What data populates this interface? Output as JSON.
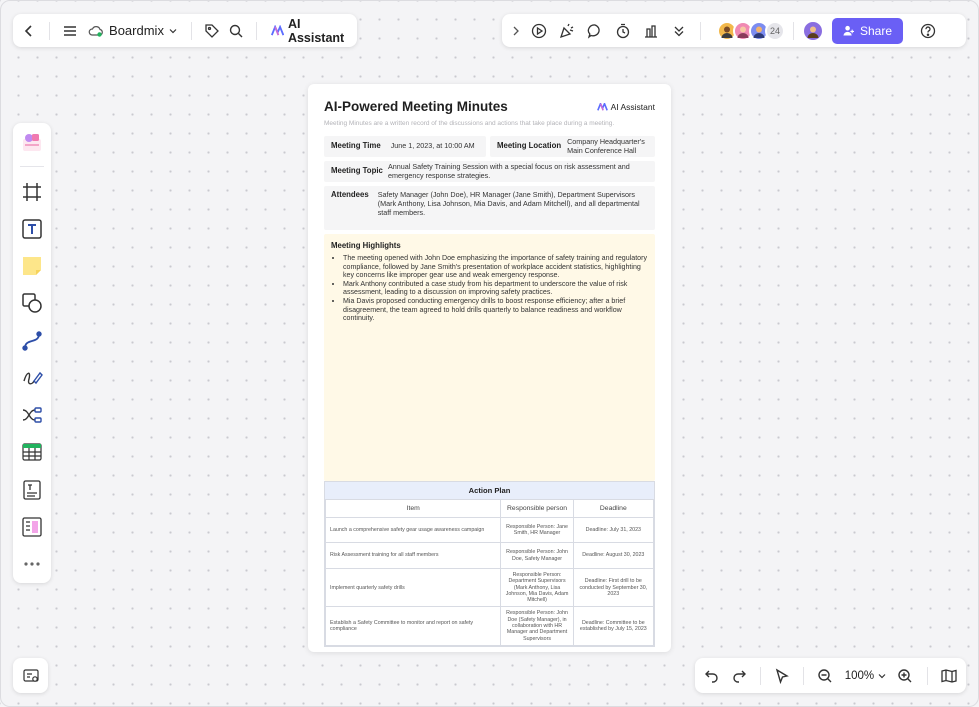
{
  "toolbar": {
    "brand_label": "Boardmix",
    "ai_assistant_label": "AI Assistant",
    "collaborator_count": "24",
    "share_label": "Share"
  },
  "zoom": {
    "level": "100%"
  },
  "document": {
    "title": "AI-Powered Meeting Minutes",
    "ai_badge": "AI Assistant",
    "subtitle": "Meeting Minutes are a written record of the discussions and actions that take place during a meeting.",
    "fields": {
      "time_label": "Meeting Time",
      "time_value": "June 1, 2023, at 10:00 AM",
      "location_label": "Meeting Location",
      "location_value": "Company Headquarter's Main Conference Hall",
      "topic_label": "Meeting Topic",
      "topic_value": "Annual Safety Training Session with a special focus on risk assessment and emergency response strategies.",
      "attendees_label": "Attendees",
      "attendees_value": "Safety Manager (John Doe), HR Manager (Jane Smith), Department Supervisors (Mark Anthony, Lisa Johnson, Mia Davis, and Adam Mitchell), and all departmental staff members."
    },
    "highlights": {
      "title": "Meeting Highlights",
      "items": [
        "The meeting opened with John Doe emphasizing the importance of safety training and regulatory compliance, followed by Jane Smith's presentation of workplace accident statistics, highlighting key concerns like improper gear use and weak emergency response.",
        "Mark Anthony contributed a case study from his department to underscore the value of risk assessment, leading to a discussion on improving safety practices.",
        "Mia Davis proposed conducting emergency drills to boost response efficiency; after a brief disagreement, the team agreed to hold drills quarterly to balance readiness and workflow continuity."
      ]
    },
    "action_plan": {
      "title": "Action Plan",
      "headers": [
        "Item",
        "Responsible person",
        "Deadline"
      ],
      "rows": [
        [
          "Launch a comprehensive safety gear usage awareness campaign",
          "Responsible Person: Jane Smith, HR Manager",
          "Deadline: July 31, 2023"
        ],
        [
          "Risk Assessment training for all staff members",
          "Responsible Person: John Doe, Safety Manager",
          "Deadline: August 30, 2023"
        ],
        [
          "Implement quarterly safety drills",
          "Responsible Person: Department Supervisors (Mark Anthony, Lisa Johnson, Mia Davis, Adam Mitchell)",
          "Deadline: First drill to be conducted by September 30, 2023"
        ],
        [
          "Establish a Safety Committee to monitor and report on safety compliance",
          "Responsible Person: John Doe (Safety Manager), in collaboration with HR Manager and Department Supervisors",
          "Deadline: Committee to be established by July 15, 2023"
        ]
      ]
    }
  },
  "colors": {
    "accent": "#6a5ff5",
    "highlight_bg": "#fff9e7",
    "table_header_bg": "#e8eefb"
  }
}
